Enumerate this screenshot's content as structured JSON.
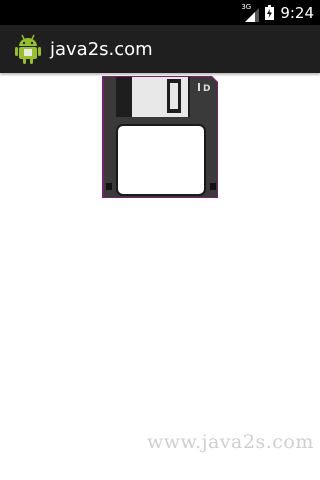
{
  "status_bar": {
    "network_type": "3G",
    "time": "9:24"
  },
  "action_bar": {
    "title": "java2s.com",
    "icon": "android-icon"
  },
  "content": {
    "image": "floppy-disk-icon",
    "floppy_label": "D"
  },
  "watermark": {
    "text": "www.java2s.com"
  },
  "colors": {
    "status_bar_bg": "#000000",
    "action_bar_bg": "#1f1f1f",
    "background": "#ffffff",
    "floppy_body": "#3a3a3a",
    "floppy_outline": "#7a1f6e",
    "android_green": "#97c024"
  }
}
